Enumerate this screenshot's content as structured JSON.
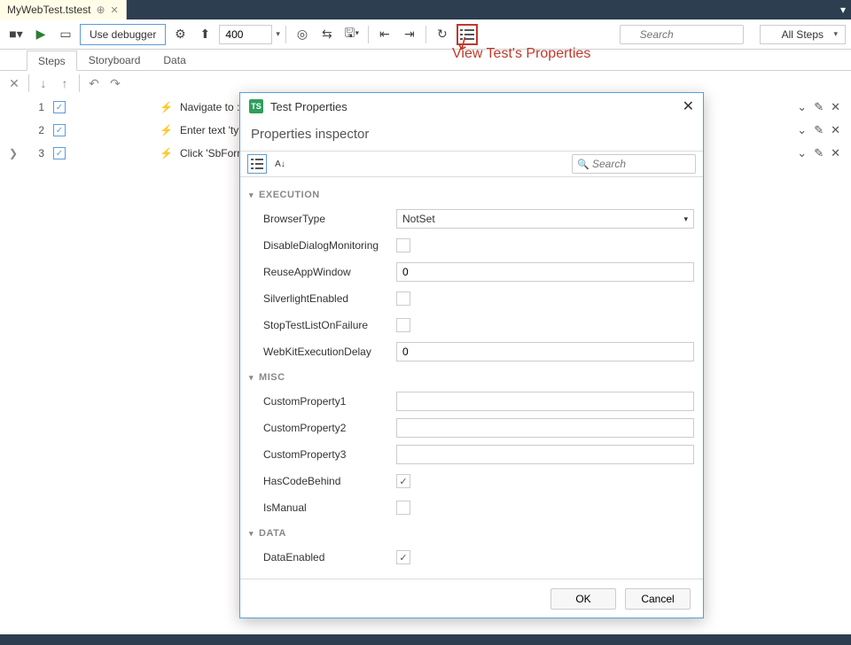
{
  "tab": {
    "title": "MyWebTest.tstest"
  },
  "toolbar": {
    "debugger_label": "Use debugger",
    "number_value": "400",
    "search_placeholder": "Search",
    "allsteps_label": "All Steps"
  },
  "subtabs": [
    "Steps",
    "Storyboard",
    "Data"
  ],
  "steps": [
    {
      "num": "1",
      "text": "Navigate to :"
    },
    {
      "num": "2",
      "text": "Enter text 'typ"
    },
    {
      "num": "3",
      "text": "Click 'SbForm"
    }
  ],
  "annotation": {
    "text": "View Test's Properties"
  },
  "dialog": {
    "title": "Test Properties",
    "subtitle": "Properties inspector",
    "search_placeholder": "Search",
    "categories": {
      "execution": "EXECUTION",
      "misc": "MISC",
      "data": "DATA"
    },
    "props": {
      "BrowserType": {
        "label": "BrowserType",
        "value": "NotSet"
      },
      "DisableDialogMonitoring": {
        "label": "DisableDialogMonitoring",
        "checked": false
      },
      "ReuseAppWindow": {
        "label": "ReuseAppWindow",
        "value": "0"
      },
      "SilverlightEnabled": {
        "label": "SilverlightEnabled",
        "checked": false
      },
      "StopTestListOnFailure": {
        "label": "StopTestListOnFailure",
        "checked": false
      },
      "WebKitExecutionDelay": {
        "label": "WebKitExecutionDelay",
        "value": "0"
      },
      "CustomProperty1": {
        "label": "CustomProperty1",
        "value": ""
      },
      "CustomProperty2": {
        "label": "CustomProperty2",
        "value": ""
      },
      "CustomProperty3": {
        "label": "CustomProperty3",
        "value": ""
      },
      "HasCodeBehind": {
        "label": "HasCodeBehind",
        "checked": true
      },
      "IsManual": {
        "label": "IsManual",
        "checked": false
      },
      "DataEnabled": {
        "label": "DataEnabled",
        "checked": true
      }
    },
    "buttons": {
      "ok": "OK",
      "cancel": "Cancel"
    }
  }
}
